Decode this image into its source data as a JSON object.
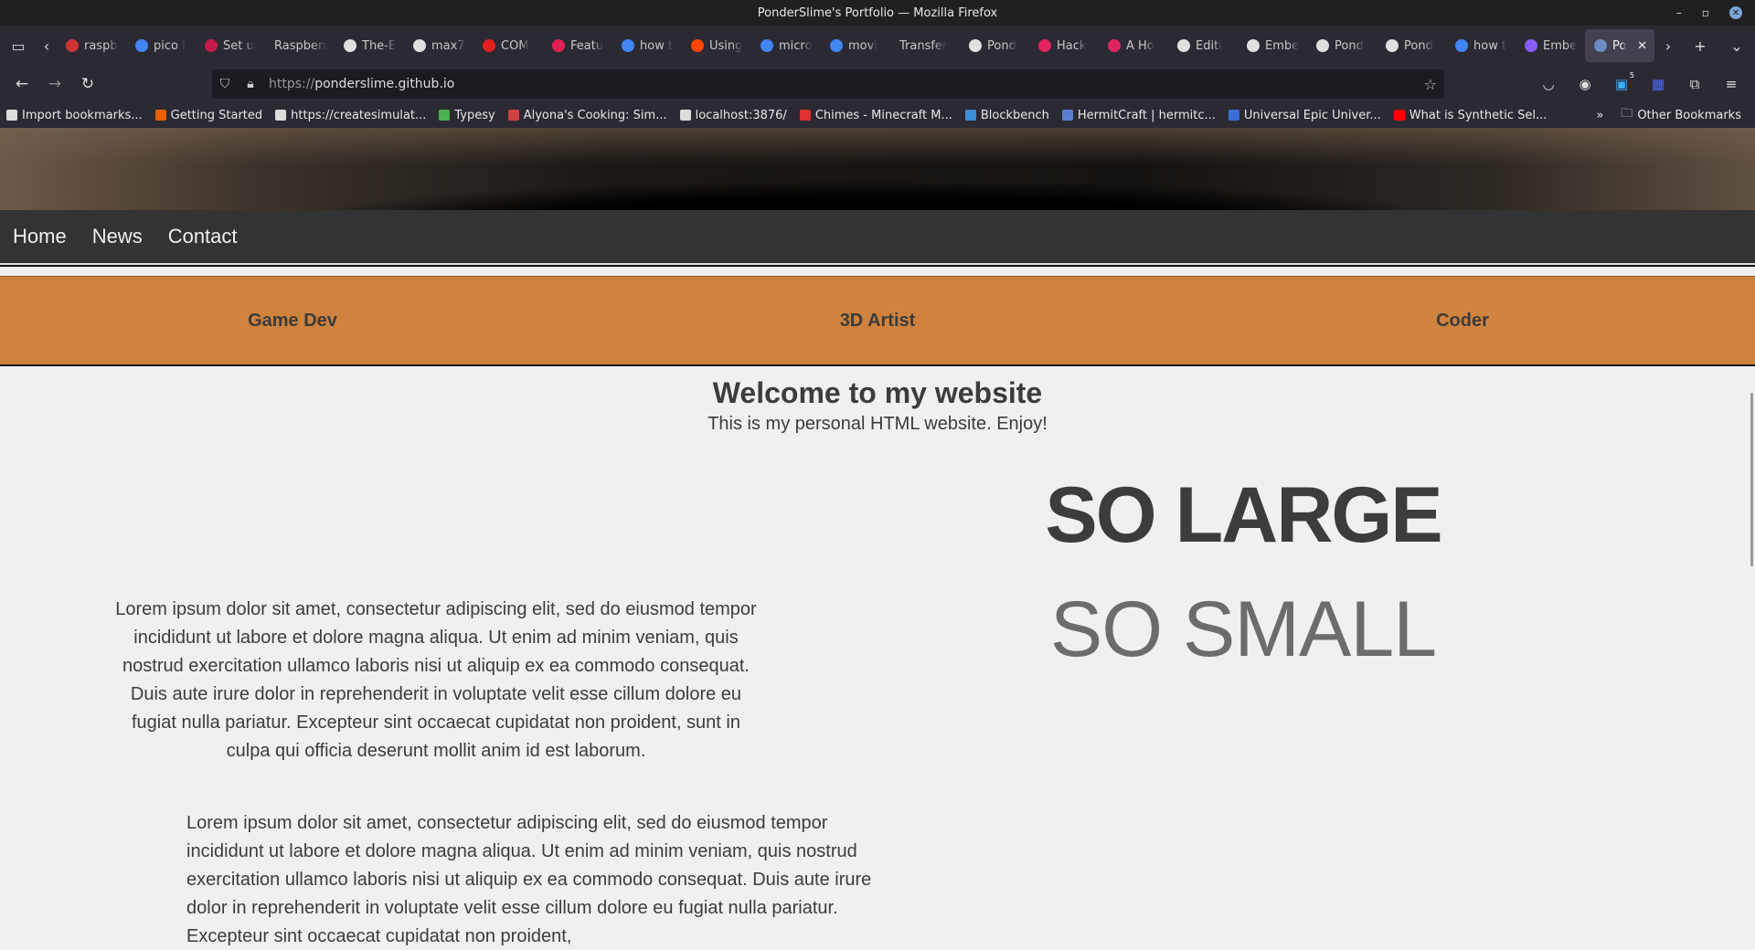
{
  "window": {
    "title": "PonderSlime's Portfolio — Mozilla Firefox"
  },
  "tabs": [
    {
      "label": "raspb",
      "color": "#cc3333"
    },
    {
      "label": "pico l",
      "color": "#4285f4"
    },
    {
      "label": "Set u",
      "color": "#c51a4a"
    },
    {
      "label": "Raspberr",
      "color": ""
    },
    {
      "label": "The-E",
      "color": "#e0e0e0"
    },
    {
      "label": "max7",
      "color": "#e0e0e0"
    },
    {
      "label": "COM",
      "color": "#e02020"
    },
    {
      "label": "Featu",
      "color": "#e02050"
    },
    {
      "label": "how t",
      "color": "#4285f4"
    },
    {
      "label": "Using",
      "color": "#ff4500"
    },
    {
      "label": "micro",
      "color": "#4285f4"
    },
    {
      "label": "movi",
      "color": "#4285f4"
    },
    {
      "label": "Transfer",
      "color": ""
    },
    {
      "label": "Pond",
      "color": "#e0e0e0"
    },
    {
      "label": "Hack",
      "color": "#e0245e"
    },
    {
      "label": "A Ho",
      "color": "#e0245e"
    },
    {
      "label": "Editi",
      "color": "#e0e0e0"
    },
    {
      "label": "Embe",
      "color": "#e0e0e0"
    },
    {
      "label": "Pond",
      "color": "#e0e0e0"
    },
    {
      "label": "Pond",
      "color": "#e0e0e0"
    },
    {
      "label": "how t",
      "color": "#4285f4"
    },
    {
      "label": "Embe",
      "color": "#8a5cf6"
    },
    {
      "label": "Po",
      "color": "#6b8cc4",
      "active": true
    }
  ],
  "url": {
    "protocol": "https://",
    "host": "ponderslime.github.io"
  },
  "bookmarks": [
    {
      "label": "Import bookmarks...",
      "color": "#dddddd"
    },
    {
      "label": "Getting Started",
      "color": "#e66000"
    },
    {
      "label": "https://createsimulat...",
      "color": "#dddddd"
    },
    {
      "label": "Typesy",
      "color": "#4caf50"
    },
    {
      "label": "Alyona's Cooking: Sim...",
      "color": "#d04040"
    },
    {
      "label": "localhost:3876/",
      "color": "#dddddd"
    },
    {
      "label": "Chimes - Minecraft M...",
      "color": "#e03030"
    },
    {
      "label": "Blockbench",
      "color": "#3a8fd8"
    },
    {
      "label": "HermitCraft | hermitc...",
      "color": "#5a7fd0"
    },
    {
      "label": "Universal Epic Univer...",
      "color": "#3a6fd8"
    },
    {
      "label": "What is Synthetic Sel...",
      "color": "#ff0000"
    }
  ],
  "bookmarks_other": "Other Bookmarks",
  "site": {
    "nav": [
      "Home",
      "News",
      "Contact"
    ],
    "roles": [
      "Game Dev",
      "3D Artist",
      "Coder"
    ],
    "welcome_title": "Welcome to my website",
    "welcome_sub": "This is my personal HTML website. Enjoy!",
    "lorem1": "Lorem ipsum dolor sit amet, consectetur adipiscing elit, sed do eiusmod tempor incididunt ut labore et dolore magna aliqua. Ut enim ad minim veniam, quis nostrud exercitation ullamco laboris nisi ut aliquip ex ea commodo consequat. Duis aute irure dolor in reprehenderit in voluptate velit esse cillum dolore eu fugiat nulla pariatur. Excepteur sint occaecat cupidatat non proident, sunt in culpa qui officia deserunt mollit anim id est laborum.",
    "lorem2": "Lorem ipsum dolor sit amet, consectetur adipiscing elit, sed do eiusmod tempor incididunt ut labore et dolore magna aliqua. Ut enim ad minim veniam, quis nostrud exercitation ullamco laboris nisi ut aliquip ex ea commodo consequat. Duis aute irure dolor in reprehenderit in voluptate velit esse cillum dolore eu fugiat nulla pariatur. Excepteur sint occaecat cupidatat non proident,",
    "so_large": "SO LARGE",
    "so_small": "SO SMALL"
  },
  "extensions_badge": "5",
  "icons": [
    "tab-list-icon",
    "back-icon",
    "forward-icon",
    "reload-icon",
    "shield-icon",
    "lock-icon",
    "star-icon",
    "pocket-icon",
    "account-icon",
    "extension-icon",
    "menu-icon",
    "close-icon",
    "new-tab-icon",
    "chevron-down-icon"
  ]
}
